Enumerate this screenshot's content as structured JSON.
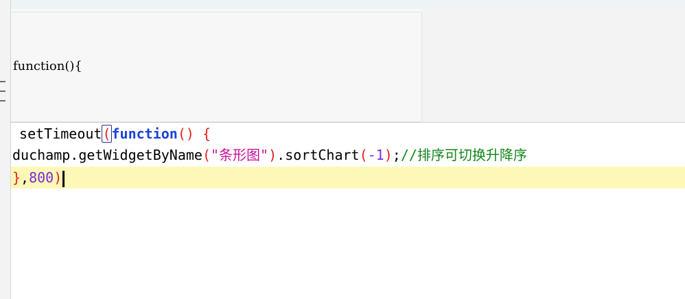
{
  "header": {
    "signature": "function(){"
  },
  "editor": {
    "line1": {
      "indent": " ",
      "fn_name": "setTimeout",
      "open_paren": "(",
      "keyword": "function",
      "parens": "()",
      "space": " ",
      "open_brace": "{"
    },
    "line2": {
      "object": "duchamp",
      "dot1": ".",
      "method1": "getWidgetByName",
      "open_paren1": "(",
      "string": "\"条形图\"",
      "close_paren1": ")",
      "dot2": ".",
      "method2": "sortChart",
      "open_paren2": "(",
      "number": "-1",
      "close_paren2": ")",
      "semicolon": ";",
      "comment": "//排序可切换升降序"
    },
    "line3": {
      "close_brace": "}",
      "comma": ",",
      "number": "800",
      "close_paren": ")"
    }
  },
  "colors": {
    "keyword": "#1a43d8",
    "string": "#c8109a",
    "number": "#7a2bd6",
    "paren": "#e0211a",
    "comment": "#13861a",
    "current_line": "#fdf8b8"
  }
}
